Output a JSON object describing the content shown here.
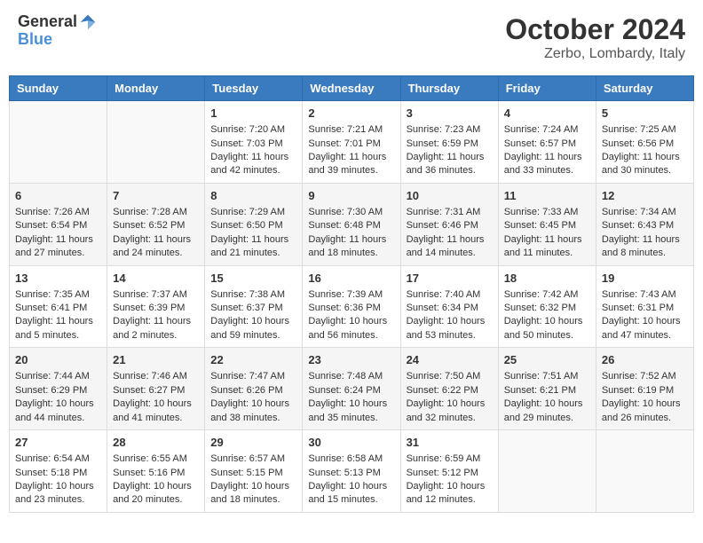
{
  "header": {
    "logo_general": "General",
    "logo_blue": "Blue",
    "month": "October 2024",
    "location": "Zerbo, Lombardy, Italy"
  },
  "weekdays": [
    "Sunday",
    "Monday",
    "Tuesday",
    "Wednesday",
    "Thursday",
    "Friday",
    "Saturday"
  ],
  "weeks": [
    [
      {
        "day": "",
        "sunrise": "",
        "sunset": "",
        "daylight": ""
      },
      {
        "day": "",
        "sunrise": "",
        "sunset": "",
        "daylight": ""
      },
      {
        "day": "1",
        "sunrise": "Sunrise: 7:20 AM",
        "sunset": "Sunset: 7:03 PM",
        "daylight": "Daylight: 11 hours and 42 minutes."
      },
      {
        "day": "2",
        "sunrise": "Sunrise: 7:21 AM",
        "sunset": "Sunset: 7:01 PM",
        "daylight": "Daylight: 11 hours and 39 minutes."
      },
      {
        "day": "3",
        "sunrise": "Sunrise: 7:23 AM",
        "sunset": "Sunset: 6:59 PM",
        "daylight": "Daylight: 11 hours and 36 minutes."
      },
      {
        "day": "4",
        "sunrise": "Sunrise: 7:24 AM",
        "sunset": "Sunset: 6:57 PM",
        "daylight": "Daylight: 11 hours and 33 minutes."
      },
      {
        "day": "5",
        "sunrise": "Sunrise: 7:25 AM",
        "sunset": "Sunset: 6:56 PM",
        "daylight": "Daylight: 11 hours and 30 minutes."
      }
    ],
    [
      {
        "day": "6",
        "sunrise": "Sunrise: 7:26 AM",
        "sunset": "Sunset: 6:54 PM",
        "daylight": "Daylight: 11 hours and 27 minutes."
      },
      {
        "day": "7",
        "sunrise": "Sunrise: 7:28 AM",
        "sunset": "Sunset: 6:52 PM",
        "daylight": "Daylight: 11 hours and 24 minutes."
      },
      {
        "day": "8",
        "sunrise": "Sunrise: 7:29 AM",
        "sunset": "Sunset: 6:50 PM",
        "daylight": "Daylight: 11 hours and 21 minutes."
      },
      {
        "day": "9",
        "sunrise": "Sunrise: 7:30 AM",
        "sunset": "Sunset: 6:48 PM",
        "daylight": "Daylight: 11 hours and 18 minutes."
      },
      {
        "day": "10",
        "sunrise": "Sunrise: 7:31 AM",
        "sunset": "Sunset: 6:46 PM",
        "daylight": "Daylight: 11 hours and 14 minutes."
      },
      {
        "day": "11",
        "sunrise": "Sunrise: 7:33 AM",
        "sunset": "Sunset: 6:45 PM",
        "daylight": "Daylight: 11 hours and 11 minutes."
      },
      {
        "day": "12",
        "sunrise": "Sunrise: 7:34 AM",
        "sunset": "Sunset: 6:43 PM",
        "daylight": "Daylight: 11 hours and 8 minutes."
      }
    ],
    [
      {
        "day": "13",
        "sunrise": "Sunrise: 7:35 AM",
        "sunset": "Sunset: 6:41 PM",
        "daylight": "Daylight: 11 hours and 5 minutes."
      },
      {
        "day": "14",
        "sunrise": "Sunrise: 7:37 AM",
        "sunset": "Sunset: 6:39 PM",
        "daylight": "Daylight: 11 hours and 2 minutes."
      },
      {
        "day": "15",
        "sunrise": "Sunrise: 7:38 AM",
        "sunset": "Sunset: 6:37 PM",
        "daylight": "Daylight: 10 hours and 59 minutes."
      },
      {
        "day": "16",
        "sunrise": "Sunrise: 7:39 AM",
        "sunset": "Sunset: 6:36 PM",
        "daylight": "Daylight: 10 hours and 56 minutes."
      },
      {
        "day": "17",
        "sunrise": "Sunrise: 7:40 AM",
        "sunset": "Sunset: 6:34 PM",
        "daylight": "Daylight: 10 hours and 53 minutes."
      },
      {
        "day": "18",
        "sunrise": "Sunrise: 7:42 AM",
        "sunset": "Sunset: 6:32 PM",
        "daylight": "Daylight: 10 hours and 50 minutes."
      },
      {
        "day": "19",
        "sunrise": "Sunrise: 7:43 AM",
        "sunset": "Sunset: 6:31 PM",
        "daylight": "Daylight: 10 hours and 47 minutes."
      }
    ],
    [
      {
        "day": "20",
        "sunrise": "Sunrise: 7:44 AM",
        "sunset": "Sunset: 6:29 PM",
        "daylight": "Daylight: 10 hours and 44 minutes."
      },
      {
        "day": "21",
        "sunrise": "Sunrise: 7:46 AM",
        "sunset": "Sunset: 6:27 PM",
        "daylight": "Daylight: 10 hours and 41 minutes."
      },
      {
        "day": "22",
        "sunrise": "Sunrise: 7:47 AM",
        "sunset": "Sunset: 6:26 PM",
        "daylight": "Daylight: 10 hours and 38 minutes."
      },
      {
        "day": "23",
        "sunrise": "Sunrise: 7:48 AM",
        "sunset": "Sunset: 6:24 PM",
        "daylight": "Daylight: 10 hours and 35 minutes."
      },
      {
        "day": "24",
        "sunrise": "Sunrise: 7:50 AM",
        "sunset": "Sunset: 6:22 PM",
        "daylight": "Daylight: 10 hours and 32 minutes."
      },
      {
        "day": "25",
        "sunrise": "Sunrise: 7:51 AM",
        "sunset": "Sunset: 6:21 PM",
        "daylight": "Daylight: 10 hours and 29 minutes."
      },
      {
        "day": "26",
        "sunrise": "Sunrise: 7:52 AM",
        "sunset": "Sunset: 6:19 PM",
        "daylight": "Daylight: 10 hours and 26 minutes."
      }
    ],
    [
      {
        "day": "27",
        "sunrise": "Sunrise: 6:54 AM",
        "sunset": "Sunset: 5:18 PM",
        "daylight": "Daylight: 10 hours and 23 minutes."
      },
      {
        "day": "28",
        "sunrise": "Sunrise: 6:55 AM",
        "sunset": "Sunset: 5:16 PM",
        "daylight": "Daylight: 10 hours and 20 minutes."
      },
      {
        "day": "29",
        "sunrise": "Sunrise: 6:57 AM",
        "sunset": "Sunset: 5:15 PM",
        "daylight": "Daylight: 10 hours and 18 minutes."
      },
      {
        "day": "30",
        "sunrise": "Sunrise: 6:58 AM",
        "sunset": "Sunset: 5:13 PM",
        "daylight": "Daylight: 10 hours and 15 minutes."
      },
      {
        "day": "31",
        "sunrise": "Sunrise: 6:59 AM",
        "sunset": "Sunset: 5:12 PM",
        "daylight": "Daylight: 10 hours and 12 minutes."
      },
      {
        "day": "",
        "sunrise": "",
        "sunset": "",
        "daylight": ""
      },
      {
        "day": "",
        "sunrise": "",
        "sunset": "",
        "daylight": ""
      }
    ]
  ]
}
